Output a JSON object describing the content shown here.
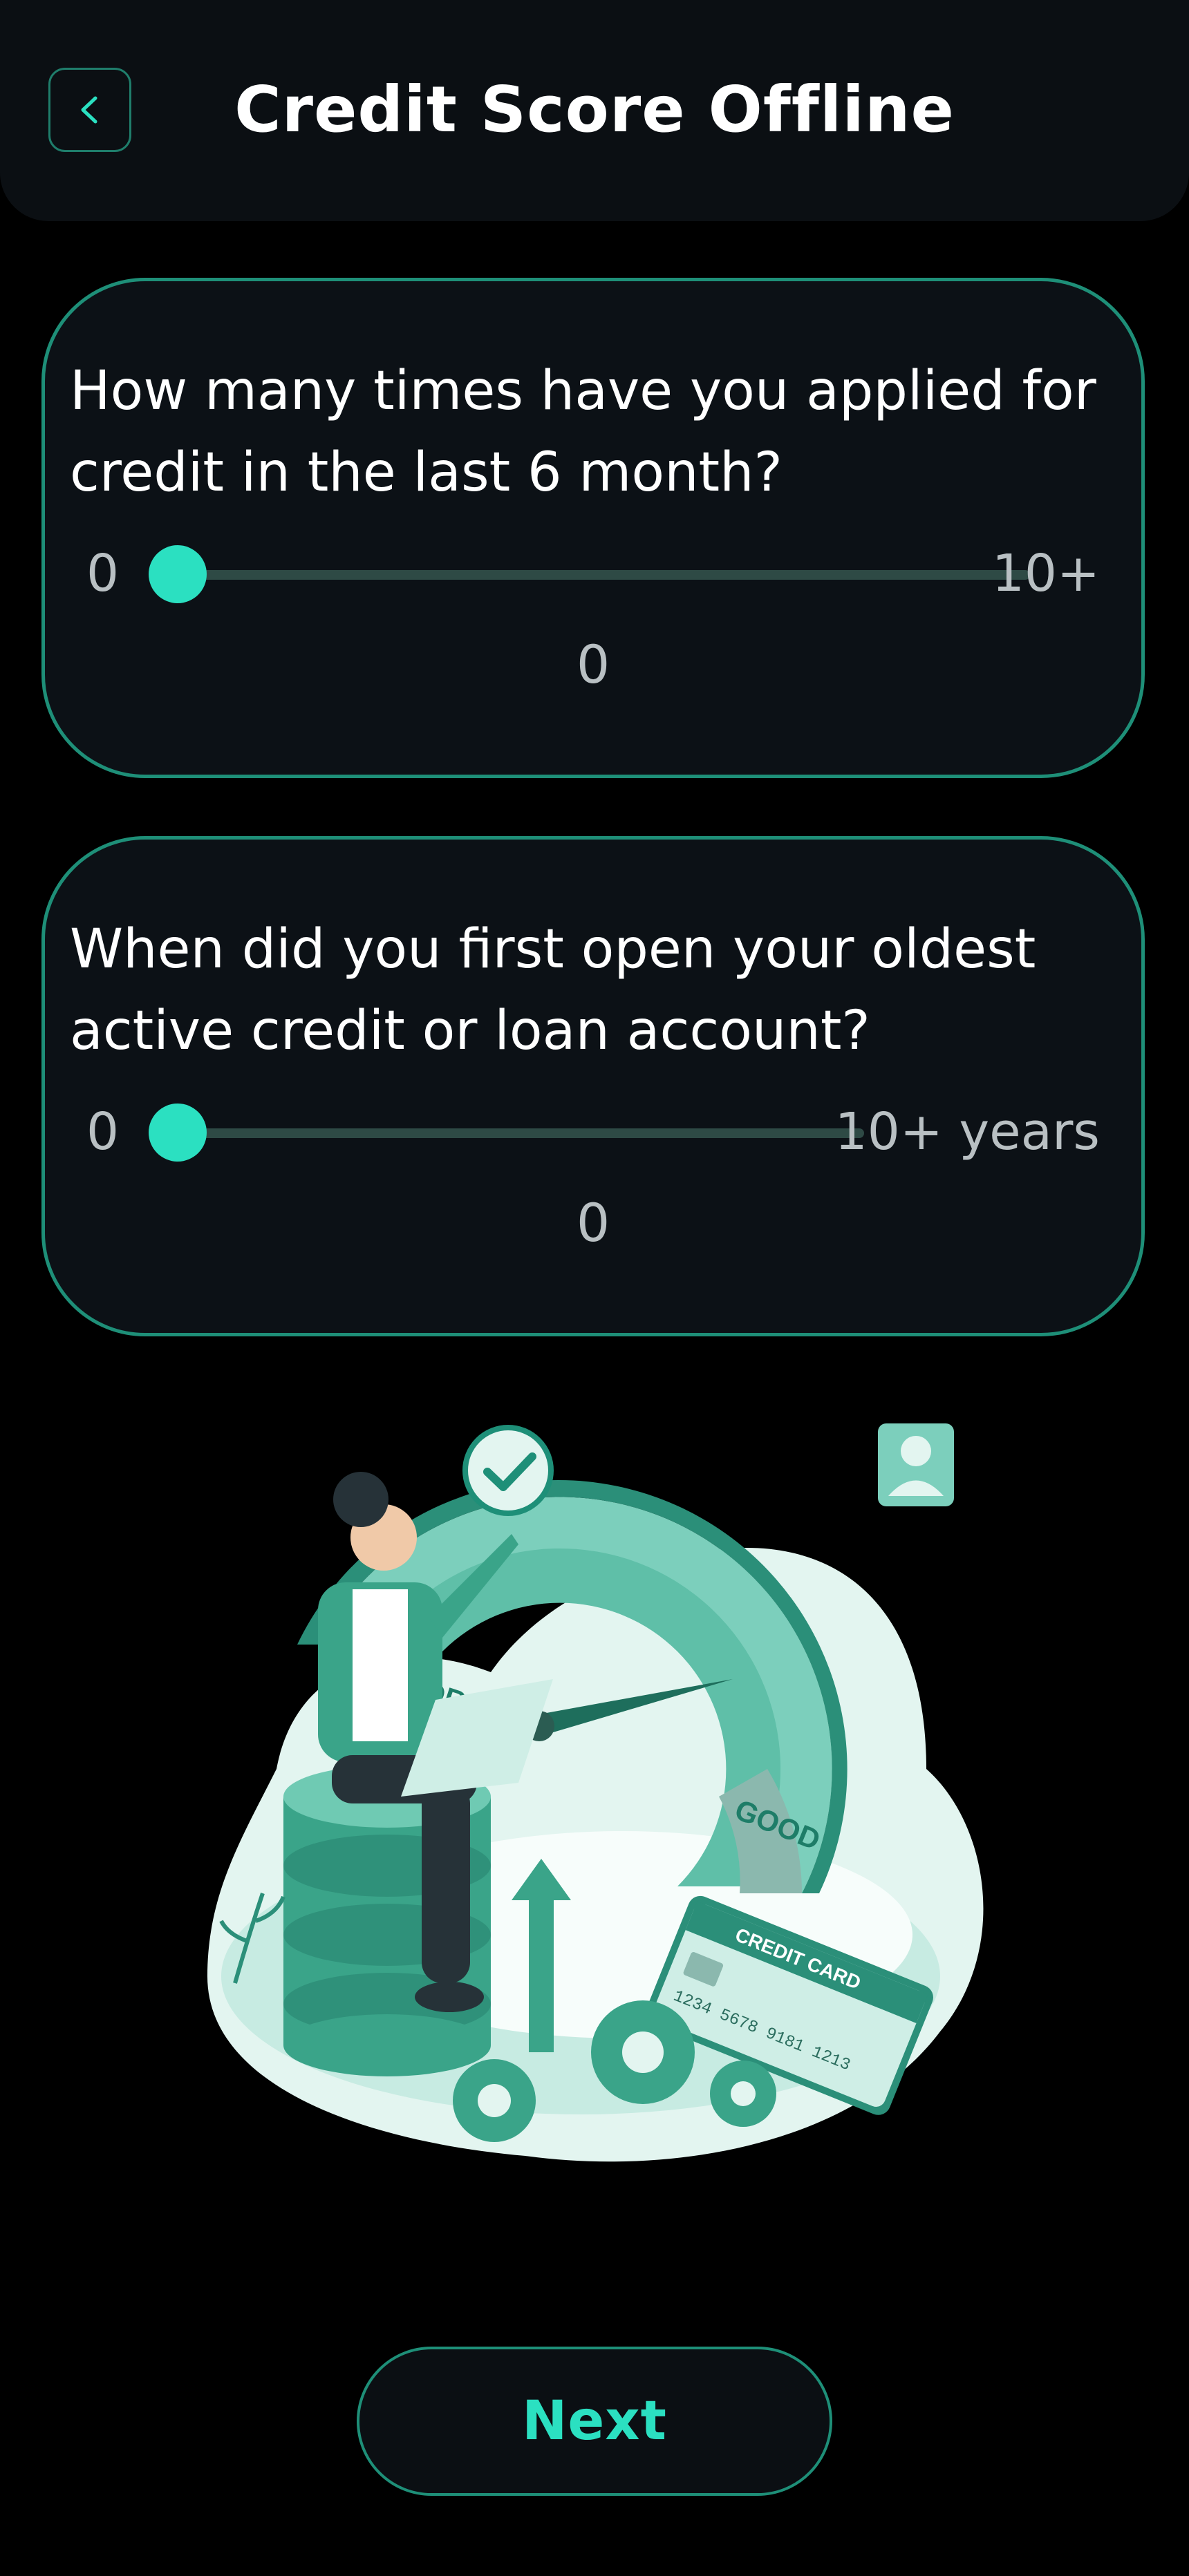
{
  "header": {
    "title": "Credit Score Offline",
    "back_icon": "chevron-left-icon"
  },
  "questions": [
    {
      "question": "How many times have you applied for credit in the last 6 month?",
      "min_label": "0",
      "max_label": "10+",
      "value": "0",
      "slider_fraction": 0
    },
    {
      "question": "When did you first open your oldest active credit or loan account?",
      "min_label": "0",
      "max_label": "10+ years",
      "value": "0",
      "slider_fraction": 0
    }
  ],
  "illustration": {
    "gauge_poor": "POOR",
    "gauge_good": "GOOD",
    "card_title": "CREDIT CARD",
    "card_number": "1234 5678 9181 1213"
  },
  "footer": {
    "next_label": "Next"
  },
  "colors": {
    "accent": "#2be0c1",
    "border": "#1e8f78",
    "card_bg": "#0c1116",
    "page_bg": "#000000"
  }
}
